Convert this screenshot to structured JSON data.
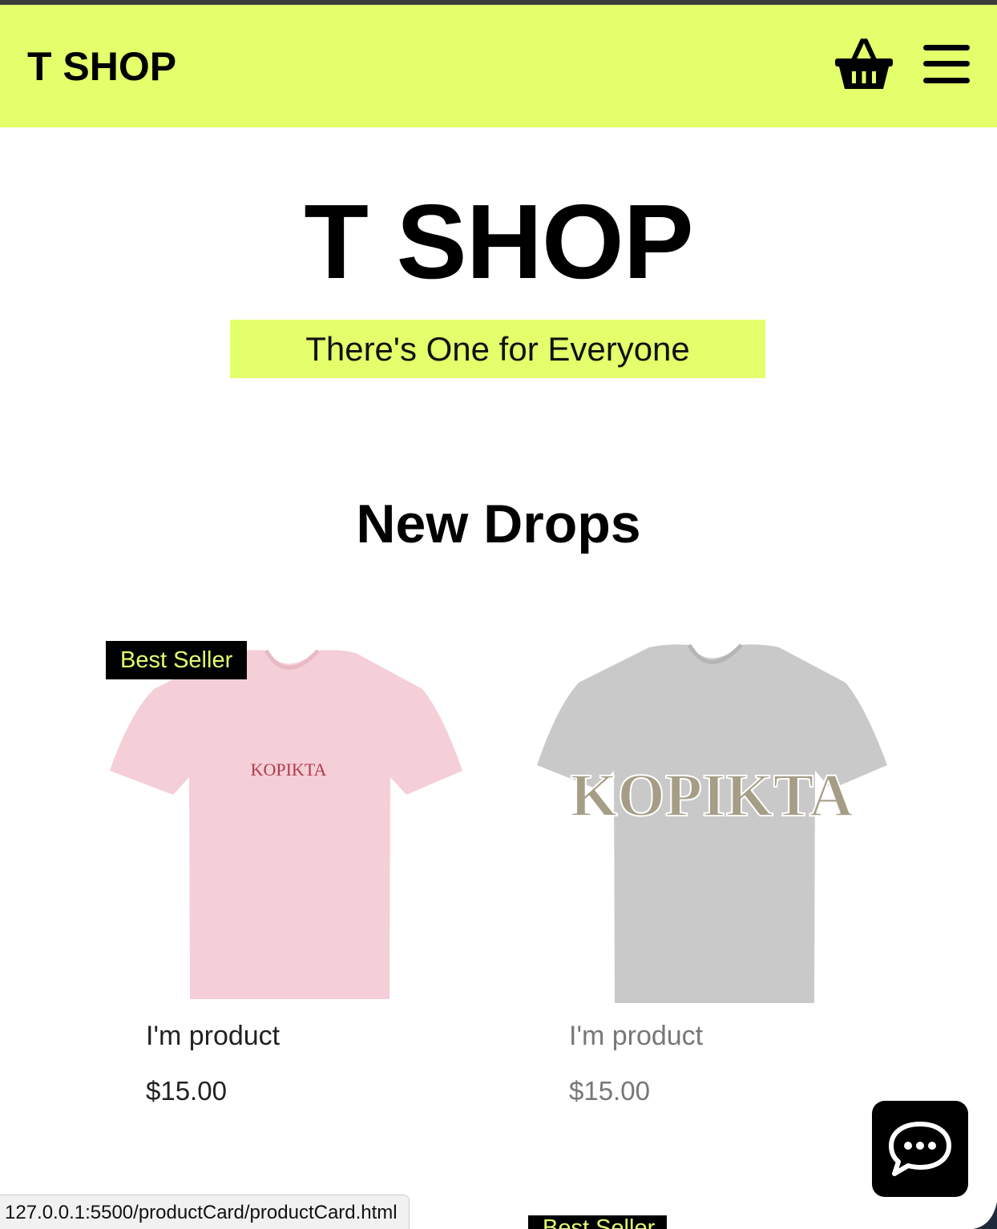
{
  "header": {
    "brand": "T SHOP",
    "cart_icon": "basket-icon",
    "menu_icon": "hamburger-menu-icon"
  },
  "hero": {
    "title": "T SHOP",
    "tagline": "There's One for Everyone"
  },
  "section": {
    "title": "New Drops"
  },
  "products": [
    {
      "badge": "Best Seller",
      "name": "I'm product",
      "price": "$15.00",
      "shirt_color": "#f4cfd8",
      "print_text": "KOPIKTA",
      "print_color": "#b23a48"
    },
    {
      "name": "I'm product",
      "price": "$15.00",
      "shirt_color": "#c9c9c9",
      "print_text": "KOPIKTA",
      "print_color": "#a59d86"
    }
  ],
  "next_row_badge": "Best Seller",
  "chat": {
    "icon": "chat-bubble-icon"
  },
  "status_bar": {
    "url": "127.0.0.1:5500/productCard/productCard.html"
  },
  "colors": {
    "accent": "#e3ff6b",
    "text": "#000000",
    "badge_bg": "#000000"
  }
}
